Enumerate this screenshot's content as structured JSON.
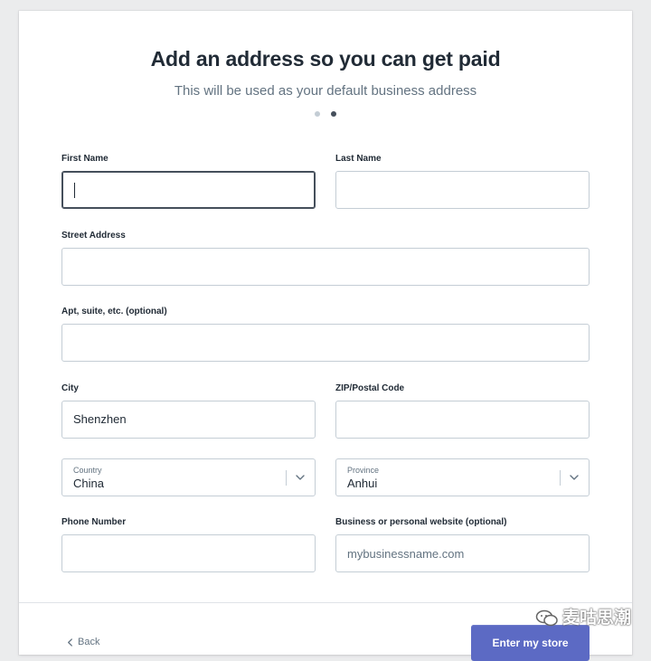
{
  "header": {
    "title": "Add an address so you can get paid",
    "subtitle": "This will be used as your default business address",
    "steps": [
      {
        "state": "inactive"
      },
      {
        "state": "active"
      }
    ]
  },
  "form": {
    "first_name": {
      "label": "First Name",
      "value": ""
    },
    "last_name": {
      "label": "Last Name",
      "value": ""
    },
    "street": {
      "label": "Street Address",
      "value": ""
    },
    "apt": {
      "label": "Apt, suite, etc. (optional)",
      "value": ""
    },
    "city": {
      "label": "City",
      "value": "Shenzhen"
    },
    "zip": {
      "label": "ZIP/Postal Code",
      "value": ""
    },
    "country": {
      "label": "Country",
      "value": "China"
    },
    "province": {
      "label": "Province",
      "value": "Anhui"
    },
    "phone": {
      "label": "Phone Number",
      "value": ""
    },
    "website": {
      "label": "Business or personal website (optional)",
      "placeholder": "mybusinessname.com",
      "value": ""
    }
  },
  "footer": {
    "back_label": "Back",
    "submit_label": "Enter my store"
  },
  "watermark": {
    "text": "麦咕思潮"
  },
  "colors": {
    "accent": "#5c6ac4",
    "background": "#ebeced",
    "card": "#ffffff",
    "border": "#c4cdd5"
  }
}
